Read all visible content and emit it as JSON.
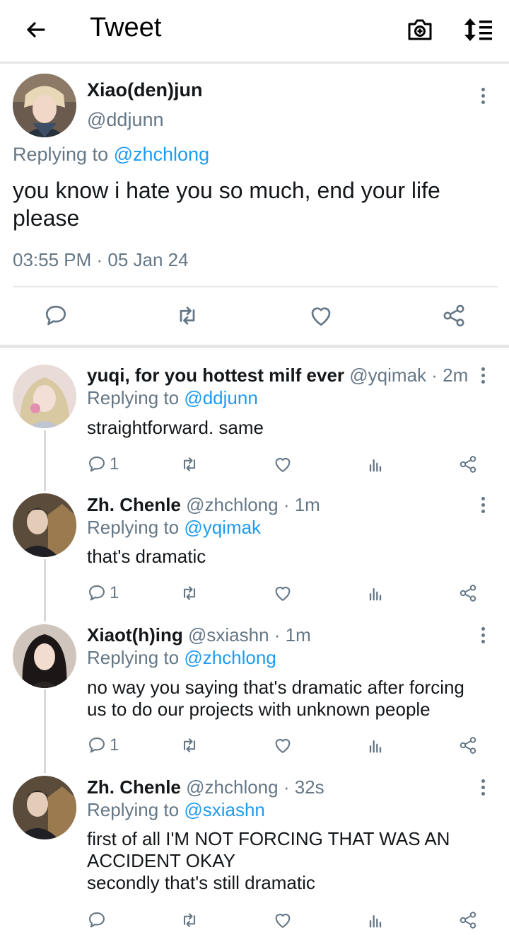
{
  "header": {
    "title": "Tweet"
  },
  "main_tweet": {
    "name": "Xiao(den)jun",
    "handle": "@ddjunn",
    "replying_prefix": "Replying to ",
    "replying_handle": "@zhchlong",
    "text": "you know i hate you so much, end your life please",
    "timestamp": "03:55 PM · 05 Jan 24"
  },
  "replies": [
    {
      "name": "yuqi, for you hottest milf ever",
      "meta": " @yqimak · 2m",
      "replying_prefix": "Replying to ",
      "replying_handle": "@ddjunn",
      "text_lines": [
        "straightforward. same"
      ],
      "reply_count": "1"
    },
    {
      "name": "Zh. Chenle",
      "meta": " @zhchlong · 1m",
      "replying_prefix": "Replying to ",
      "replying_handle": "@yqimak",
      "text_lines": [
        "that's dramatic"
      ],
      "reply_count": "1"
    },
    {
      "name": "Xiaot(h)ing",
      "meta": " @sxiashn · 1m",
      "replying_prefix": "Replying to ",
      "replying_handle": "@zhchlong",
      "text_lines": [
        "no way you saying that's dramatic after forcing",
        "us to do our projects with unknown people"
      ],
      "reply_count": "1"
    },
    {
      "name": "Zh. Chenle",
      "meta": " @zhchlong · 32s",
      "replying_prefix": "Replying to ",
      "replying_handle": "@sxiashn",
      "text_lines": [
        "first of all I'M NOT FORCING THAT WAS AN",
        "ACCIDENT OKAY",
        "secondly that's still dramatic"
      ],
      "reply_count": ""
    }
  ],
  "icons": {
    "back": "arrow-left-icon",
    "camera": "camera-icon",
    "sort": "sort-icon",
    "more": "more-vertical-icon",
    "reply": "comment-icon",
    "retweet": "retweet-icon",
    "like": "heart-icon",
    "analytics": "bar-chart-icon",
    "share": "share-icon"
  },
  "colors": {
    "link": "#1d9bf0",
    "muted": "#657786",
    "text": "#14171a",
    "divider": "#e6e6e6"
  }
}
